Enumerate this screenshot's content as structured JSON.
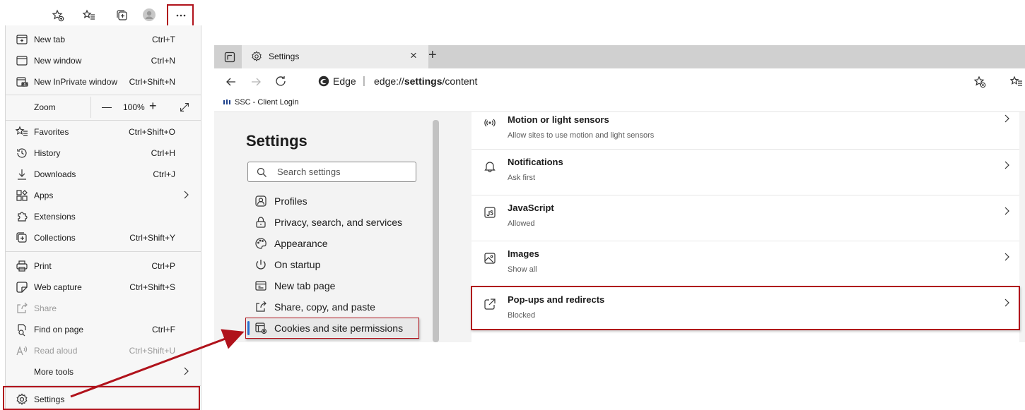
{
  "menu": {
    "items": [
      {
        "label": "New tab",
        "shortcut": "Ctrl+T",
        "icon": "new-tab-icon"
      },
      {
        "label": "New window",
        "shortcut": "Ctrl+N",
        "icon": "new-window-icon"
      },
      {
        "label": "New InPrivate window",
        "shortcut": "Ctrl+Shift+N",
        "icon": "inprivate-icon"
      },
      {
        "label": "Favorites",
        "shortcut": "Ctrl+Shift+O",
        "icon": "favorites-icon"
      },
      {
        "label": "History",
        "shortcut": "Ctrl+H",
        "icon": "history-icon"
      },
      {
        "label": "Downloads",
        "shortcut": "Ctrl+J",
        "icon": "download-icon"
      },
      {
        "label": "Apps",
        "shortcut": "",
        "icon": "apps-icon"
      },
      {
        "label": "Extensions",
        "shortcut": "",
        "icon": "extensions-icon"
      },
      {
        "label": "Collections",
        "shortcut": "Ctrl+Shift+Y",
        "icon": "collections-icon"
      },
      {
        "label": "Print",
        "shortcut": "Ctrl+P",
        "icon": "print-icon"
      },
      {
        "label": "Web capture",
        "shortcut": "Ctrl+Shift+S",
        "icon": "web-capture-icon"
      },
      {
        "label": "Share",
        "shortcut": "",
        "icon": "share-icon"
      },
      {
        "label": "Find on page",
        "shortcut": "Ctrl+F",
        "icon": "find-icon"
      },
      {
        "label": "Read aloud",
        "shortcut": "Ctrl+Shift+U",
        "icon": "read-aloud-icon"
      },
      {
        "label": "More tools",
        "shortcut": "",
        "icon": ""
      },
      {
        "label": "Settings",
        "shortcut": "",
        "icon": "gear-icon"
      }
    ],
    "zoom": {
      "label": "Zoom",
      "minus": "—",
      "value": "100%",
      "plus": "+"
    }
  },
  "browser": {
    "tab_title": "Settings",
    "tab_close": "×",
    "new_tab": "+",
    "address": {
      "brand": "Edge",
      "separator": "|",
      "url_prefix": "edge://",
      "url_bold": "settings",
      "url_suffix": "/content"
    },
    "favorite": "SSC - Client Login"
  },
  "settings": {
    "heading": "Settings",
    "search_placeholder": "Search settings",
    "nav": [
      {
        "label": "Profiles",
        "icon": "profile-icon"
      },
      {
        "label": "Privacy, search, and services",
        "icon": "lock-icon"
      },
      {
        "label": "Appearance",
        "icon": "palette-icon"
      },
      {
        "label": "On startup",
        "icon": "power-icon"
      },
      {
        "label": "New tab page",
        "icon": "new-tab-page-icon"
      },
      {
        "label": "Share, copy, and paste",
        "icon": "share-icon"
      },
      {
        "label": "Cookies and site permissions",
        "icon": "cookies-icon"
      }
    ],
    "permissions": [
      {
        "title": "Motion or light sensors",
        "subtitle": "Allow sites to use motion and light sensors",
        "icon": "sensors-icon"
      },
      {
        "title": "Notifications",
        "subtitle": "Ask first",
        "icon": "bell-icon"
      },
      {
        "title": "JavaScript",
        "subtitle": "Allowed",
        "icon": "javascript-icon"
      },
      {
        "title": "Images",
        "subtitle": "Show all",
        "icon": "image-icon"
      },
      {
        "title": "Pop-ups and redirects",
        "subtitle": "Blocked",
        "icon": "popup-icon"
      }
    ]
  },
  "colors": {
    "highlight": "#b0121b",
    "selected_indicator": "#2a6fcf"
  }
}
